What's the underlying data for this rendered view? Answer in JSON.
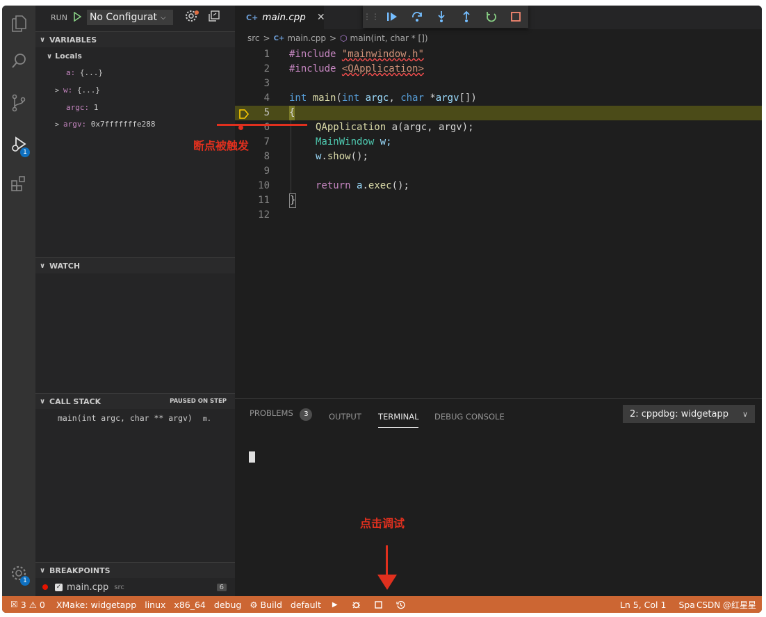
{
  "activity_bar": {
    "debug_badge": "1",
    "settings_badge": "1"
  },
  "run_bar": {
    "run_label": "RUN",
    "config_name": "No Configurat"
  },
  "variables": {
    "header": "VARIABLES",
    "locals_label": "Locals",
    "items": [
      {
        "name": "a:",
        "value": "{...}"
      },
      {
        "name": "w:",
        "value": "{...}"
      },
      {
        "name": "argc:",
        "value": "1"
      },
      {
        "name": "argv:",
        "value": "0x7fffffffe288"
      }
    ]
  },
  "watch": {
    "header": "WATCH"
  },
  "call_stack": {
    "header": "CALL STACK",
    "status": "PAUSED ON STEP",
    "frame": "main(int argc, char ** argv)",
    "frame_suffix": "m."
  },
  "breakpoints": {
    "header": "BREAKPOINTS",
    "file": "main.cpp",
    "folder": "src",
    "count": "6"
  },
  "editor": {
    "tab_label": "main.cpp",
    "breadcrumb": {
      "folder": "src",
      "file": "main.cpp",
      "symbol": "main(int, char * [])"
    },
    "line_numbers": [
      "1",
      "2",
      "3",
      "4",
      "5",
      "6",
      "7",
      "8",
      "9",
      "10",
      "11",
      "12"
    ],
    "code": {
      "l1_kw": "#include",
      "l1_str": "\"mainwindow.h\"",
      "l2_kw": "#include",
      "l2_str": "<QApplication>",
      "l4_int": "int",
      "l4_main": "main",
      "l4_p1": "(",
      "l4_int2": "int",
      "l4_argc": "argc",
      "l4_p2": ", ",
      "l4_char": "char",
      "l4_star": " *",
      "l4_argv": "argv",
      "l4_p3": "[])",
      "l5": "{",
      "l6_type": "QApplication",
      "l6_rest": " a(argc, argv);",
      "l7_type": "MainWindow",
      "l7_rest": " w;",
      "l8_obj": "w",
      "l8_fn": "show",
      "l8_rest": "();",
      "l10_kw": "return",
      "l10_obj": "a",
      "l10_fn": "exec",
      "l10_rest": "();",
      "l11": "}"
    }
  },
  "panel": {
    "tabs": [
      "PROBLEMS",
      "OUTPUT",
      "TERMINAL",
      "DEBUG CONSOLE"
    ],
    "problems_count": "3",
    "terminal_select": "2: cppdbg: widgetapp"
  },
  "status_bar": {
    "errors": "3",
    "warnings": "0",
    "xmake": "XMake: widgetapp",
    "platform": "linux",
    "arch": "x86_64",
    "mode": "debug",
    "build": "Build",
    "target": "default",
    "position": "Ln 5, Col 1",
    "spaces": "Spa",
    "watermark": "CSDN @红星星"
  },
  "annotations": {
    "breakpoint_hit": "断点被触发",
    "click_debug": "点击调试"
  },
  "colors": {
    "statusbar": "#cc6633",
    "annotation": "#e0301e",
    "current_line": "#4b4b18"
  }
}
